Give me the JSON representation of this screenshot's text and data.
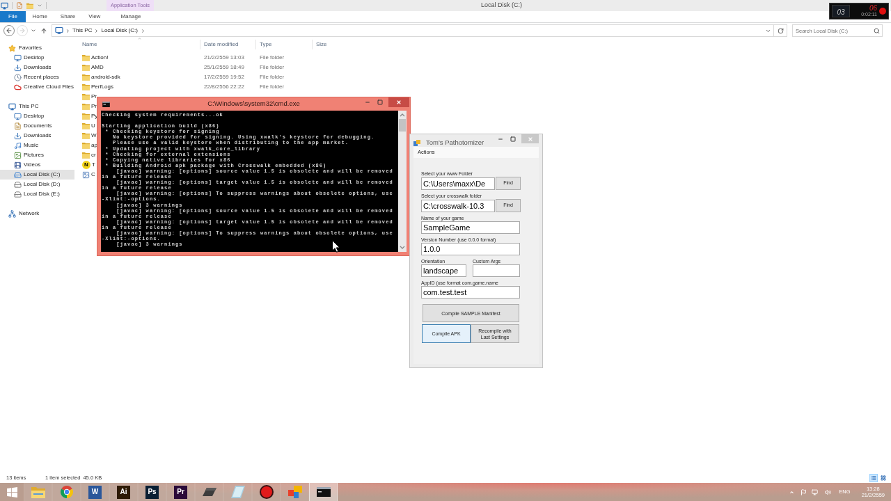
{
  "explorer": {
    "title": "Local Disk (C:)",
    "contextual_tab": "Application Tools",
    "ribbon_tabs": [
      {
        "label": "File",
        "kind": "file"
      },
      {
        "label": "Home",
        "kind": "tab"
      },
      {
        "label": "Share",
        "kind": "tab"
      },
      {
        "label": "View",
        "kind": "tab"
      },
      {
        "label": "Manage",
        "kind": "contextual"
      }
    ],
    "history": {
      "back_disabled": false,
      "forward_disabled": true
    },
    "address": {
      "path": [
        "This PC",
        "Local Disk (C:)"
      ]
    },
    "search": {
      "placeholder": "Search Local Disk (C:)"
    },
    "nav": [
      {
        "label": "Favorites",
        "kind": "star",
        "selected": false,
        "children": [
          {
            "label": "Desktop",
            "kind": "desktop",
            "selected": false
          },
          {
            "label": "Downloads",
            "kind": "downloads",
            "selected": false
          },
          {
            "label": "Recent places",
            "kind": "recent",
            "selected": false
          },
          {
            "label": "Creative Cloud Files",
            "kind": "cloud",
            "selected": false
          }
        ]
      },
      {
        "label": "This PC",
        "kind": "pc",
        "selected": false,
        "children": [
          {
            "label": "Desktop",
            "kind": "desktop",
            "selected": false
          },
          {
            "label": "Documents",
            "kind": "documents",
            "selected": false
          },
          {
            "label": "Downloads",
            "kind": "downloads",
            "selected": false
          },
          {
            "label": "Music",
            "kind": "music",
            "selected": false
          },
          {
            "label": "Pictures",
            "kind": "pictures",
            "selected": false
          },
          {
            "label": "Videos",
            "kind": "videos",
            "selected": false
          },
          {
            "label": "Local Disk (C:)",
            "kind": "system_disk",
            "selected": true
          },
          {
            "label": "Local Disk (D:)",
            "kind": "disk",
            "selected": false
          },
          {
            "label": "Local Disk (E:)",
            "kind": "disk",
            "selected": false
          }
        ]
      },
      {
        "label": "Network",
        "kind": "network",
        "selected": false
      }
    ],
    "columns": [
      {
        "label": "Name",
        "sorted": true
      },
      {
        "label": "Date modified",
        "sorted": false
      },
      {
        "label": "Type",
        "sorted": false
      },
      {
        "label": "Size",
        "sorted": false
      }
    ],
    "rows": [
      {
        "kind": "folder",
        "name": "Action!",
        "date": "21/2/2559 13:03",
        "type": "File folder"
      },
      {
        "kind": "folder",
        "name": "AMD",
        "date": "25/1/2559 18:49",
        "type": "File folder"
      },
      {
        "kind": "folder",
        "name": "android-sdk",
        "date": "17/2/2559 19:52",
        "type": "File folder"
      },
      {
        "kind": "folder",
        "name": "PerfLogs",
        "date": "22/8/2556 22:22",
        "type": "File folder"
      },
      {
        "kind": "folder",
        "name": "Pr"
      },
      {
        "kind": "folder",
        "name": "Pr"
      },
      {
        "kind": "folder",
        "name": "Py"
      },
      {
        "kind": "folder",
        "name": "U"
      },
      {
        "kind": "folder",
        "name": "W"
      },
      {
        "kind": "folder",
        "name": "ap"
      },
      {
        "kind": "folder",
        "name": "cr"
      },
      {
        "kind": "badge",
        "glyph": "N",
        "name": "T"
      },
      {
        "kind": "image",
        "name": "C"
      }
    ],
    "status": {
      "count": "13 items",
      "selection": "1 item selected",
      "size": "45.0 KB"
    },
    "views": [
      {
        "kind": "details",
        "selected": true
      },
      {
        "kind": "icons",
        "selected": false
      }
    ]
  },
  "console": {
    "title": "C:\\Windows\\system32\\cmd.exe",
    "active": true,
    "blocks": [
      [
        "Checking system requirements...ok"
      ],
      [
        "Starting application build (x86)",
        " * Checking keystore for signing",
        "   No keystore provided for signing. Using xwalk's keystore for debugging.",
        "   Please use a valid keystore when distributing to the app market.",
        " * Updating project with xwalk_core_library",
        " * Checking for external extensions",
        " * Copying native libraries for x86",
        " * Building Android apk package with Crosswalk embedded (x86)",
        "    [javac] warning: [options] source value 1.5 is obsolete and will be removed",
        "in a future release",
        "    [javac] warning: [options] target value 1.5 is obsolete and will be removed",
        "in a future release",
        "    [javac] warning: [options] To suppress warnings about obsolete options, use",
        "-Xlint:-options.",
        "    [javac] 3 warnings",
        "    [javac] warning: [options] source value 1.5 is obsolete and will be removed",
        "in a future release",
        "    [javac] warning: [options] target value 1.5 is obsolete and will be removed",
        "in a future release",
        "    [javac] warning: [options] To suppress warnings about obsolete options, use",
        "-Xlint:-options.",
        "    [javac] 3 warnings"
      ]
    ]
  },
  "pathotomizer": {
    "title": "Tom's Pathotomizer",
    "active": false,
    "menu": [
      "Actions"
    ],
    "form": [
      {
        "kind": "browse",
        "label": "Select your www Folder",
        "value": "C:\\Users\\maxx\\De",
        "button": "Find"
      },
      {
        "kind": "browse",
        "label": "Select your crosswalk folder",
        "value": "C:\\crosswalk-10.3",
        "button": "Find"
      },
      {
        "kind": "text",
        "label": "Name of your game",
        "value": "SampleGame"
      },
      {
        "kind": "text",
        "label": "Version Number (use 0.0.0 format)",
        "value": "1.0.0"
      },
      {
        "kind": "pair",
        "fields": [
          {
            "label": "Orientation",
            "value": "landscape"
          },
          {
            "label": "Custom Args"
          }
        ]
      },
      {
        "kind": "text",
        "label": "AppID (use format com.game.name",
        "value": "com.test.test"
      }
    ],
    "actions": [
      [
        {
          "label": "Compile SAMPLE Manifest",
          "focused": false
        }
      ],
      [
        {
          "label": "Compile APK",
          "focused": true
        },
        {
          "label": "Recompile with Last Settings",
          "focused": false
        }
      ]
    ]
  },
  "recorder_hud": {
    "left_number": "03",
    "right_number": "06",
    "time": "0:02:11"
  },
  "taskbar": {
    "apps": [
      {
        "kind": "folder",
        "selected": false
      },
      {
        "kind": "browser",
        "selected": false
      },
      {
        "kind": "letter",
        "glyph": "W",
        "color": "#2b579a",
        "selected": false
      },
      {
        "kind": "letter",
        "glyph": "Ai",
        "color": "#2e1a05",
        "selected": false
      },
      {
        "kind": "letter",
        "glyph": "Ps",
        "color": "#0a1f33",
        "selected": false
      },
      {
        "kind": "letter",
        "glyph": "Pr",
        "color": "#2a0a38",
        "selected": false
      },
      {
        "kind": "eraser",
        "selected": false
      },
      {
        "kind": "tablet",
        "selected": false
      },
      {
        "kind": "record",
        "selected": false
      },
      {
        "kind": "tiles",
        "selected": false
      },
      {
        "kind": "console",
        "selected": true
      }
    ],
    "tray": {
      "language": "ENG",
      "time": "13:28",
      "date": "21/2/2559"
    }
  }
}
